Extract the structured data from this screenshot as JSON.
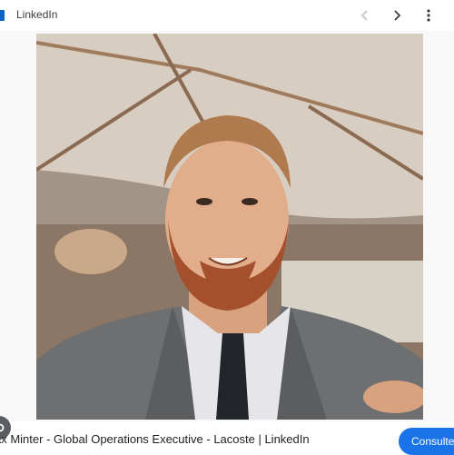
{
  "header": {
    "site_name": "LinkedIn",
    "brand_color": "#0a66c2",
    "icons": [
      "linkedin-favicon-icon",
      "chevron-left-icon",
      "chevron-right-icon",
      "more-vert-icon"
    ]
  },
  "image": {
    "description_icon": "lens-icon"
  },
  "footer": {
    "caption": "ax Minter - Global Operations Executive - Lacoste | LinkedIn",
    "visit_label": "Consulter",
    "accent_color": "#1a73e8"
  }
}
